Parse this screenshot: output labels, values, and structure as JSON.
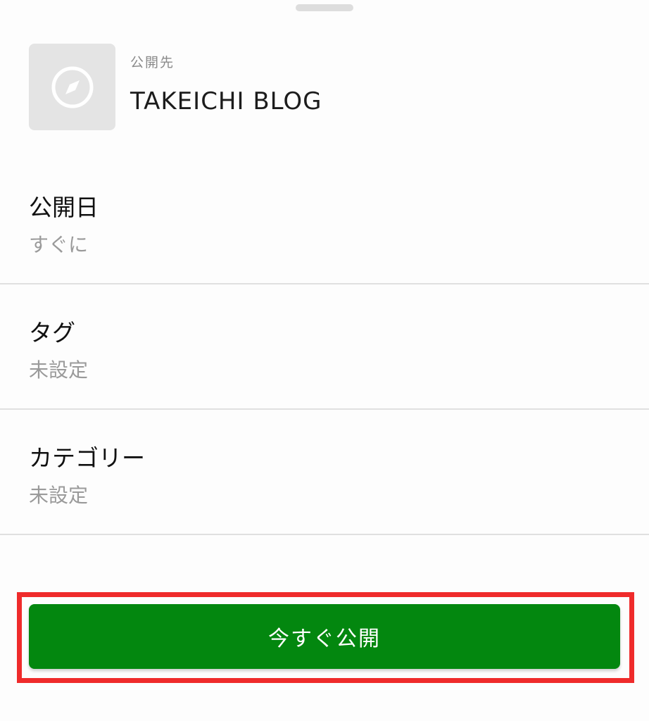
{
  "destination": {
    "caption": "公開先",
    "name": "TAKEICHI BLOG",
    "icon": "compass-icon"
  },
  "settings": [
    {
      "label": "公開日",
      "value": "すぐに"
    },
    {
      "label": "タグ",
      "value": "未設定"
    },
    {
      "label": "カテゴリー",
      "value": "未設定"
    }
  ],
  "publish_button": {
    "label": "今すぐ公開"
  },
  "colors": {
    "accent": "#03870f",
    "highlight": "#ef2b2b"
  }
}
